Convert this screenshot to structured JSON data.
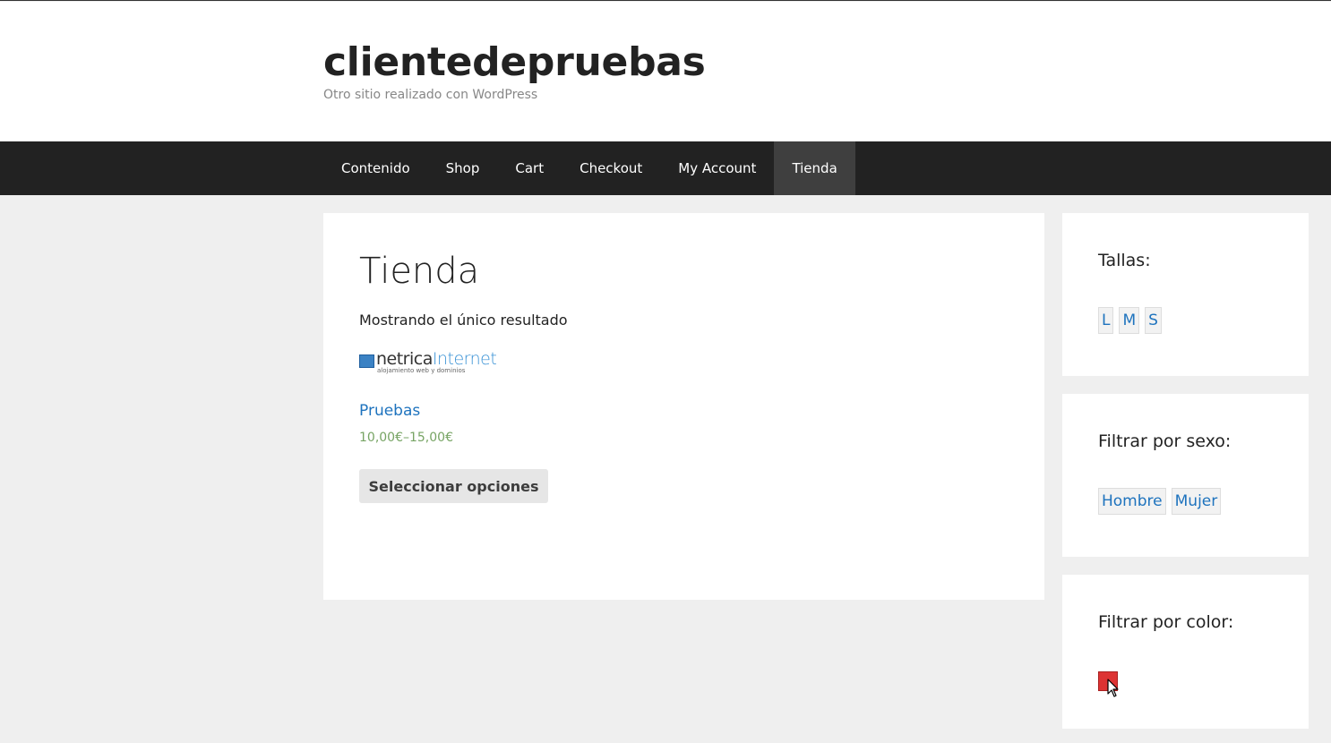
{
  "site": {
    "title": "clientedepruebas",
    "tagline": "Otro sitio realizado con WordPress"
  },
  "nav": {
    "items": [
      {
        "label": "Contenido",
        "current": false
      },
      {
        "label": "Shop",
        "current": false
      },
      {
        "label": "Cart",
        "current": false
      },
      {
        "label": "Checkout",
        "current": false
      },
      {
        "label": "My Account",
        "current": false
      },
      {
        "label": "Tienda",
        "current": true
      }
    ]
  },
  "main": {
    "page_title": "Tienda",
    "result_count": "Mostrando el único resultado",
    "product": {
      "image_text_dark": "netrica",
      "image_text_light": "Internet",
      "image_subtext": "alojamiento web y dominios",
      "name": "Pruebas",
      "price": "10,00€–15,00€",
      "button_label": "Seleccionar opciones"
    }
  },
  "sidebar": {
    "sizes_widget": {
      "title": "Tallas:",
      "terms": [
        "L",
        "M",
        "S"
      ]
    },
    "gender_widget": {
      "title": "Filtrar por sexo:",
      "terms": [
        "Hombre",
        "Mujer"
      ]
    },
    "color_widget": {
      "title": "Filtrar por color:",
      "swatches": [
        {
          "color": "#dd3333"
        }
      ]
    }
  },
  "colors": {
    "nav_background": "#222222",
    "nav_current": "#3f3f3f",
    "link": "#1e73be",
    "price": "#77a464",
    "page_background": "#efefef"
  }
}
